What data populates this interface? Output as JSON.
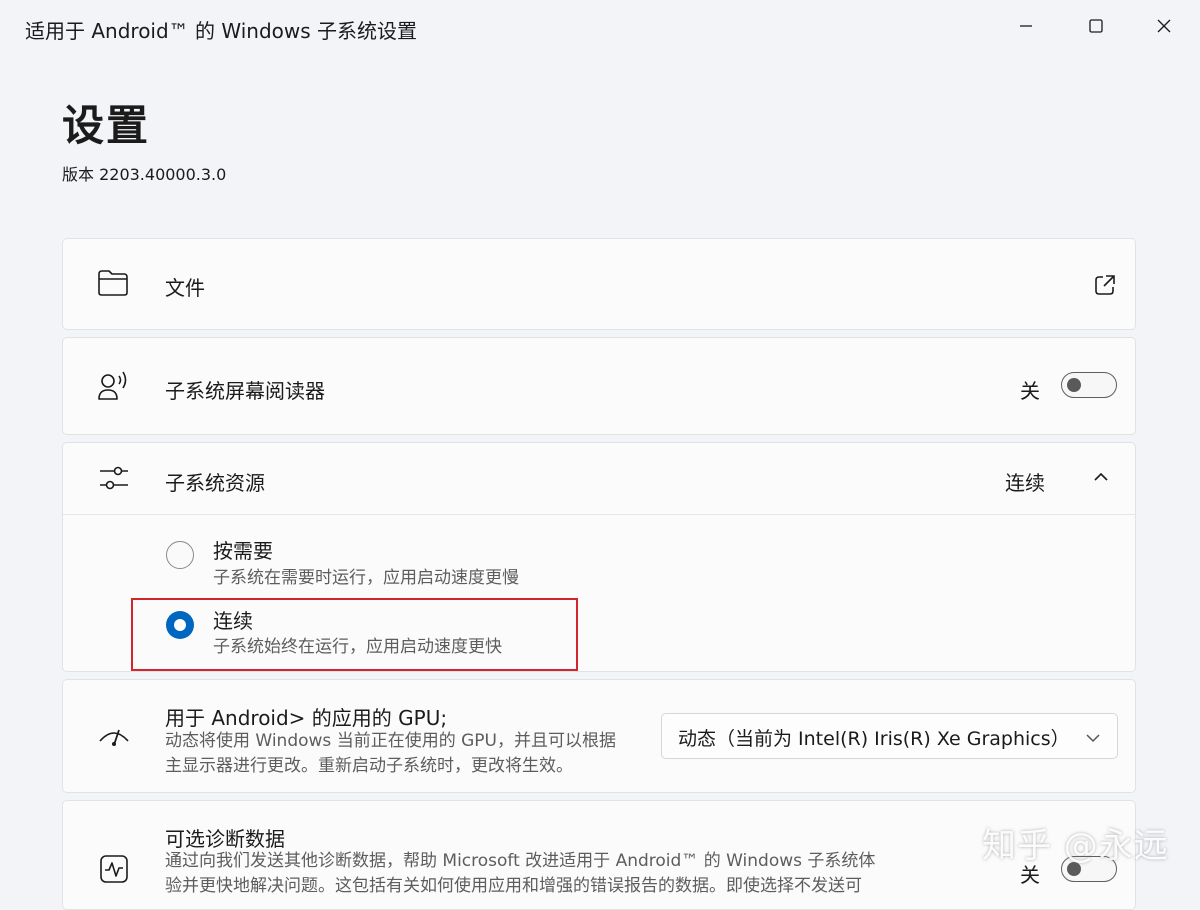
{
  "window": {
    "title": "适用于 Android™ 的 Windows 子系统设置",
    "minimize_icon": "minimize-icon",
    "maximize_icon": "maximize-icon",
    "close_icon": "close-icon"
  },
  "page": {
    "title": "设置",
    "version": "版本 2203.40000.3.0"
  },
  "files": {
    "icon": "folder-icon",
    "label": "文件",
    "action_icon": "open-external-icon"
  },
  "screen_reader": {
    "icon": "screen-reader-icon",
    "label": "子系统屏幕阅读器",
    "state": "关",
    "on": false
  },
  "resources": {
    "icon": "sliders-icon",
    "label": "子系统资源",
    "value": "连续",
    "expanded": true,
    "options": [
      {
        "title": "按需要",
        "desc": "子系统在需要时运行，应用启动速度更慢",
        "selected": false
      },
      {
        "title": "连续",
        "desc": "子系统始终在运行，应用启动速度更快",
        "selected": true
      }
    ],
    "highlight_color": "#d2262e"
  },
  "gpu": {
    "icon": "gpu-icon",
    "label": "用于 Android> 的应用的 GPU;",
    "desc_line1": "动态将使用 Windows 当前正在使用的 GPU，并且可以根据",
    "desc_line2": "主显示器进行更改。重新启动子系统时，更改将生效。",
    "selected": "动态（当前为 Intel(R) Iris(R) Xe Graphics）"
  },
  "diagnostics": {
    "icon": "activity-icon",
    "label": "可选诊断数据",
    "desc_line1": "通过向我们发送其他诊断数据，帮助 Microsoft 改进适用于 Android™ 的 Windows 子系统体",
    "desc_line2": "验并更快地解决问题。这包括有关如何使用应用和增强的错误报告的数据。即使选择不发送可",
    "state": "关",
    "on": false
  },
  "watermark": "知乎 @永远",
  "colors": {
    "accent": "#0067c0",
    "background": "#f2f4f8",
    "card": "#fbfbfc"
  }
}
